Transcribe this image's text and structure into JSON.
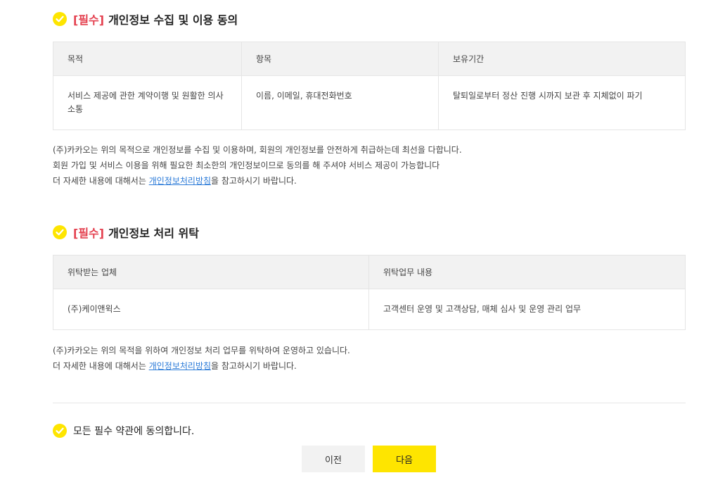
{
  "section1": {
    "required": "[필수]",
    "title": "개인정보 수집 및 이용 동의",
    "table": {
      "headers": [
        "목적",
        "항목",
        "보유기간"
      ],
      "row": [
        "서비스 제공에 관한 계약이행 및 원활한 의사소통",
        "이름, 이메일, 휴대전화번호",
        "탈퇴일로부터 정산 진행 시까지 보관 후 지체없이 파기"
      ]
    },
    "note_line1": "(주)카카오는 위의 목적으로 개인정보를 수집 및 이용하며, 회원의 개인정보를 안전하게 취급하는데 최선을 다합니다.",
    "note_line2": "회원 가입 및 서비스 이용을 위해 필요한 최소한의 개인정보이므로 동의를 해 주셔야 서비스 제공이 가능합니다",
    "note_line3_pre": "더 자세한 내용에 대해서는 ",
    "note_link": "개인정보처리방침",
    "note_line3_post": "을 참고하시기 바랍니다."
  },
  "section2": {
    "required": "[필수]",
    "title": "개인정보 처리 위탁",
    "table": {
      "headers": [
        "위탁받는 업체",
        "위탁업무 내용"
      ],
      "row": [
        "(주)케이앤윅스",
        "고객센터 운영 및 고객상담, 매체 심사 및 운영 관리 업무"
      ]
    },
    "note_line1": "(주)카카오는 위의 목적을 위하여 개인정보 처리 업무를 위탁하여 운영하고 있습니다.",
    "note_line2_pre": "더 자세한 내용에 대해서는 ",
    "note_link": "개인정보처리방침",
    "note_line2_post": "을 참고하시기 바랍니다."
  },
  "all_agree": "모든 필수 약관에 동의합니다.",
  "buttons": {
    "prev": "이전",
    "next": "다음"
  },
  "colors": {
    "accent": "#FEE500",
    "required": "#E4404F",
    "link": "#2a7ad8"
  }
}
